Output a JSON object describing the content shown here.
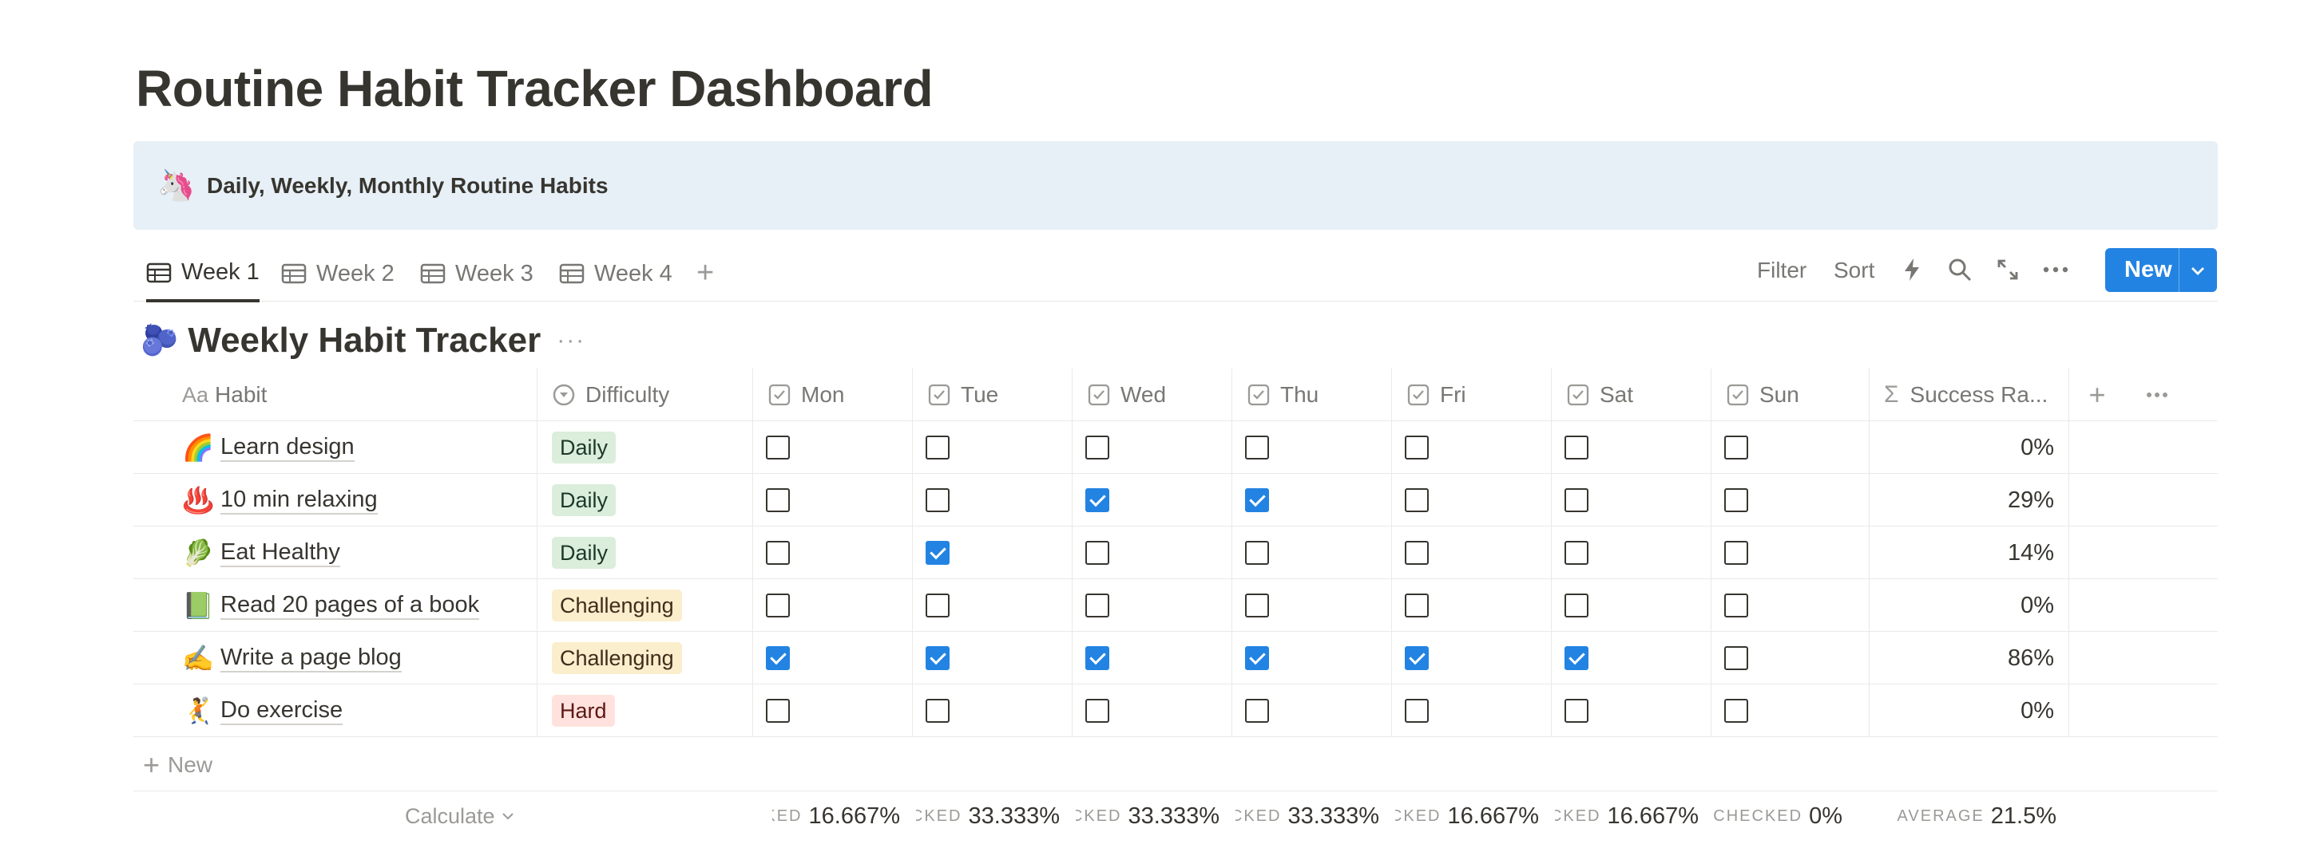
{
  "page": {
    "title": "Routine Habit Tracker Dashboard"
  },
  "callout": {
    "emoji": "🦄",
    "text": "Daily, Weekly, Monthly Routine Habits"
  },
  "tabs": [
    {
      "label": "Week 1",
      "active": true
    },
    {
      "label": "Week 2",
      "active": false
    },
    {
      "label": "Week 3",
      "active": false
    },
    {
      "label": "Week 4",
      "active": false
    }
  ],
  "toolbar": {
    "filter": "Filter",
    "sort": "Sort",
    "new": "New"
  },
  "database": {
    "emoji": "🫐",
    "title": "Weekly Habit Tracker"
  },
  "columns": {
    "habit": "Habit",
    "habit_icon": "Aa",
    "difficulty": "Difficulty",
    "days": [
      "Mon",
      "Tue",
      "Wed",
      "Thu",
      "Fri",
      "Sat",
      "Sun"
    ],
    "success": "Success Ra..."
  },
  "rows": [
    {
      "emoji": "🌈",
      "name": "Learn design",
      "difficulty": "Daily",
      "color": "green",
      "checks": [
        false,
        false,
        false,
        false,
        false,
        false,
        false
      ],
      "success": "0%"
    },
    {
      "emoji": "♨️",
      "name": "10 min relaxing",
      "difficulty": "Daily",
      "color": "green",
      "checks": [
        false,
        false,
        true,
        true,
        false,
        false,
        false
      ],
      "success": "29%"
    },
    {
      "emoji": "🥬",
      "name": "Eat Healthy",
      "difficulty": "Daily",
      "color": "green",
      "checks": [
        false,
        true,
        false,
        false,
        false,
        false,
        false
      ],
      "success": "14%"
    },
    {
      "emoji": "📗",
      "name": "Read 20 pages of a book",
      "difficulty": "Challenging",
      "color": "yellow",
      "checks": [
        false,
        false,
        false,
        false,
        false,
        false,
        false
      ],
      "success": "0%"
    },
    {
      "emoji": "✍️",
      "name": "Write a page blog",
      "difficulty": "Challenging",
      "color": "yellow",
      "checks": [
        true,
        true,
        true,
        true,
        true,
        true,
        false
      ],
      "success": "86%"
    },
    {
      "emoji": "🤾",
      "name": "Do exercise",
      "difficulty": "Hard",
      "color": "red",
      "checks": [
        false,
        false,
        false,
        false,
        false,
        false,
        false
      ],
      "success": "0%"
    }
  ],
  "new_row": {
    "label": "New"
  },
  "calc": {
    "calculate": "Calculate",
    "items": [
      {
        "label": "CHECKED",
        "value": "16.667%"
      },
      {
        "label": "CHECKED",
        "value": "33.333%"
      },
      {
        "label": "CHECKED",
        "value": "33.333%"
      },
      {
        "label": "CHECKED",
        "value": "33.333%"
      },
      {
        "label": "CHECKED",
        "value": "16.667%"
      },
      {
        "label": "CHECKED",
        "value": "16.667%"
      },
      {
        "label": "CHECKED",
        "value": "0%"
      },
      {
        "label": "AVERAGE",
        "value": "21.5%"
      }
    ]
  },
  "colors": {
    "accent": "#2383e2",
    "callout_bg": "#e7f0f7"
  }
}
